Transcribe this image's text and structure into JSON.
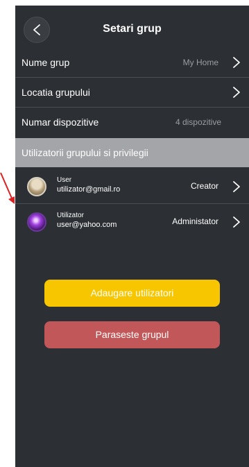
{
  "header": {
    "title": "Setari grup"
  },
  "rows": [
    {
      "label": "Nume grup",
      "value": "My Home"
    },
    {
      "label": "Locatia grupului",
      "value": ""
    },
    {
      "label": "Numar dispozitive",
      "value": "4 dispozitive"
    }
  ],
  "section": {
    "label": "Utilizatorii grupului si privilegii"
  },
  "users": [
    {
      "name": "User",
      "email": "utilizator@gmail.ro",
      "role": "Creator"
    },
    {
      "name": "Utilizator",
      "email": "user@yahoo.com",
      "role": "Administator"
    }
  ],
  "buttons": {
    "add_users": "Adaugare utilizatori",
    "leave_group": "Paraseste grupul"
  },
  "colors": {
    "background": "#2c2f33",
    "accent_yellow": "#f7c600",
    "danger_red": "#c2575a",
    "section_gray": "#a3a5a8",
    "annotation_arrow": "#e02020"
  }
}
